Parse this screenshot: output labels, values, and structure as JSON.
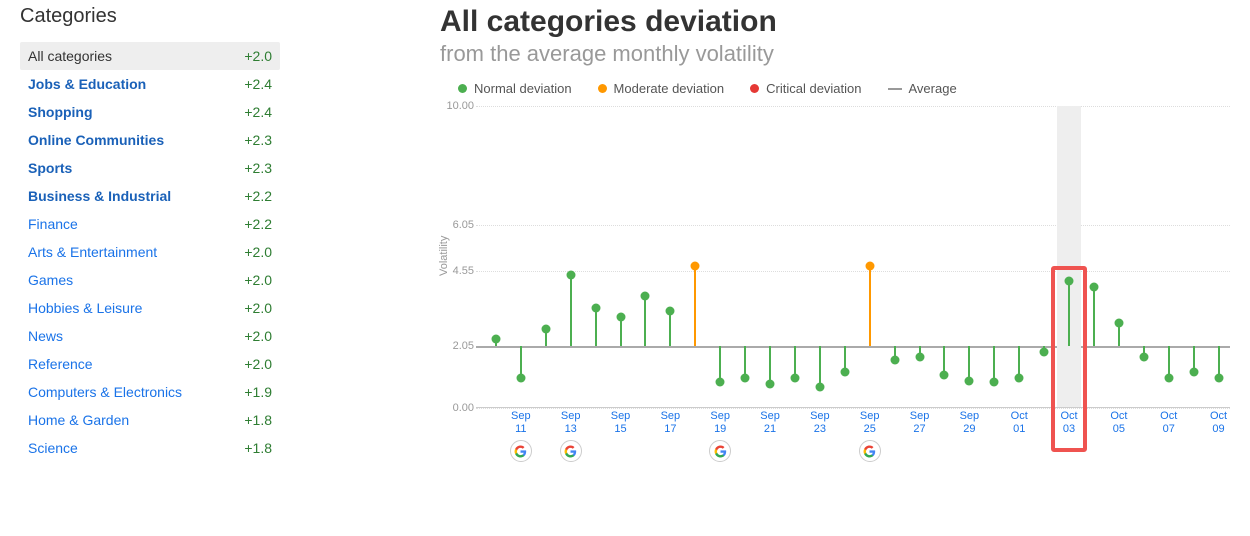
{
  "sidebar": {
    "title": "Categories",
    "items": [
      {
        "label": "All categories",
        "value": "+2.0",
        "selected": true,
        "bold": false
      },
      {
        "label": "Jobs & Education",
        "value": "+2.4",
        "bold": true
      },
      {
        "label": "Shopping",
        "value": "+2.4",
        "bold": true
      },
      {
        "label": "Online Communities",
        "value": "+2.3",
        "bold": true
      },
      {
        "label": "Sports",
        "value": "+2.3",
        "bold": true
      },
      {
        "label": "Business & Industrial",
        "value": "+2.2",
        "bold": true
      },
      {
        "label": "Finance",
        "value": "+2.2",
        "bold": false
      },
      {
        "label": "Arts & Entertainment",
        "value": "+2.0",
        "bold": false
      },
      {
        "label": "Games",
        "value": "+2.0",
        "bold": false
      },
      {
        "label": "Hobbies & Leisure",
        "value": "+2.0",
        "bold": false
      },
      {
        "label": "News",
        "value": "+2.0",
        "bold": false
      },
      {
        "label": "Reference",
        "value": "+2.0",
        "bold": false
      },
      {
        "label": "Computers & Electronics",
        "value": "+1.9",
        "bold": false
      },
      {
        "label": "Home & Garden",
        "value": "+1.8",
        "bold": false
      },
      {
        "label": "Science",
        "value": "+1.8",
        "bold": false
      }
    ]
  },
  "chart": {
    "title": "All categories deviation",
    "subtitle": "from the average monthly volatility",
    "ylabel": "Volatility"
  },
  "legend": {
    "normal": "Normal deviation",
    "moderate": "Moderate deviation",
    "critical": "Critical deviation",
    "average": "Average"
  },
  "colors": {
    "normal": "#4caf50",
    "moderate": "#ff9800",
    "critical": "#e53935",
    "average": "#999"
  },
  "chart_data": {
    "type": "bar",
    "ylabel": "Volatility",
    "ylim": [
      0,
      10
    ],
    "yticks": [
      0.0,
      2.05,
      4.55,
      6.05,
      10.0
    ],
    "average": 2.05,
    "xticks": [
      {
        "label": "Sep 11",
        "at": 1,
        "google": true
      },
      {
        "label": "Sep 13",
        "at": 3,
        "google": true
      },
      {
        "label": "Sep 15",
        "at": 5
      },
      {
        "label": "Sep 17",
        "at": 7
      },
      {
        "label": "Sep 19",
        "at": 9,
        "google": true
      },
      {
        "label": "Sep 21",
        "at": 11
      },
      {
        "label": "Sep 23",
        "at": 13
      },
      {
        "label": "Sep 25",
        "at": 15,
        "google": true
      },
      {
        "label": "Sep 27",
        "at": 17
      },
      {
        "label": "Sep 29",
        "at": 19
      },
      {
        "label": "Oct 01",
        "at": 21
      },
      {
        "label": "Oct 03",
        "at": 23
      },
      {
        "label": "Oct 05",
        "at": 25
      },
      {
        "label": "Oct 07",
        "at": 27
      },
      {
        "label": "Oct 09",
        "at": 29
      }
    ],
    "points": [
      {
        "i": 0,
        "date": "Sep 10",
        "value": 2.3,
        "level": "normal"
      },
      {
        "i": 1,
        "date": "Sep 11",
        "value": 1.0,
        "level": "normal"
      },
      {
        "i": 2,
        "date": "Sep 12",
        "value": 2.6,
        "level": "normal"
      },
      {
        "i": 3,
        "date": "Sep 13",
        "value": 4.4,
        "level": "normal"
      },
      {
        "i": 4,
        "date": "Sep 14",
        "value": 3.3,
        "level": "normal"
      },
      {
        "i": 5,
        "date": "Sep 15",
        "value": 3.0,
        "level": "normal"
      },
      {
        "i": 6,
        "date": "Sep 16",
        "value": 3.7,
        "level": "normal"
      },
      {
        "i": 7,
        "date": "Sep 17",
        "value": 3.2,
        "level": "normal"
      },
      {
        "i": 8,
        "date": "Sep 18",
        "value": 4.7,
        "level": "moderate"
      },
      {
        "i": 9,
        "date": "Sep 19",
        "value": 0.85,
        "level": "normal"
      },
      {
        "i": 10,
        "date": "Sep 20",
        "value": 1.0,
        "level": "normal"
      },
      {
        "i": 11,
        "date": "Sep 21",
        "value": 0.8,
        "level": "normal"
      },
      {
        "i": 12,
        "date": "Sep 22",
        "value": 1.0,
        "level": "normal"
      },
      {
        "i": 13,
        "date": "Sep 23",
        "value": 0.7,
        "level": "normal"
      },
      {
        "i": 14,
        "date": "Sep 24",
        "value": 1.2,
        "level": "normal"
      },
      {
        "i": 15,
        "date": "Sep 25",
        "value": 4.7,
        "level": "moderate"
      },
      {
        "i": 16,
        "date": "Sep 26",
        "value": 1.6,
        "level": "normal"
      },
      {
        "i": 17,
        "date": "Sep 27",
        "value": 1.7,
        "level": "normal"
      },
      {
        "i": 18,
        "date": "Sep 28",
        "value": 1.1,
        "level": "normal"
      },
      {
        "i": 19,
        "date": "Sep 29",
        "value": 0.9,
        "level": "normal"
      },
      {
        "i": 20,
        "date": "Sep 30",
        "value": 0.85,
        "level": "normal"
      },
      {
        "i": 21,
        "date": "Oct 01",
        "value": 1.0,
        "level": "normal"
      },
      {
        "i": 22,
        "date": "Oct 02",
        "value": 1.85,
        "level": "normal"
      },
      {
        "i": 23,
        "date": "Oct 03",
        "value": 4.2,
        "level": "normal"
      },
      {
        "i": 24,
        "date": "Oct 04",
        "value": 4.0,
        "level": "normal"
      },
      {
        "i": 25,
        "date": "Oct 05",
        "value": 2.8,
        "level": "normal"
      },
      {
        "i": 26,
        "date": "Oct 06",
        "value": 1.7,
        "level": "normal"
      },
      {
        "i": 27,
        "date": "Oct 07",
        "value": 1.0,
        "level": "normal"
      },
      {
        "i": 28,
        "date": "Oct 08",
        "value": 1.2,
        "level": "normal"
      },
      {
        "i": 29,
        "date": "Oct 09",
        "value": 1.0,
        "level": "normal"
      }
    ],
    "highlighted_index": 23
  }
}
